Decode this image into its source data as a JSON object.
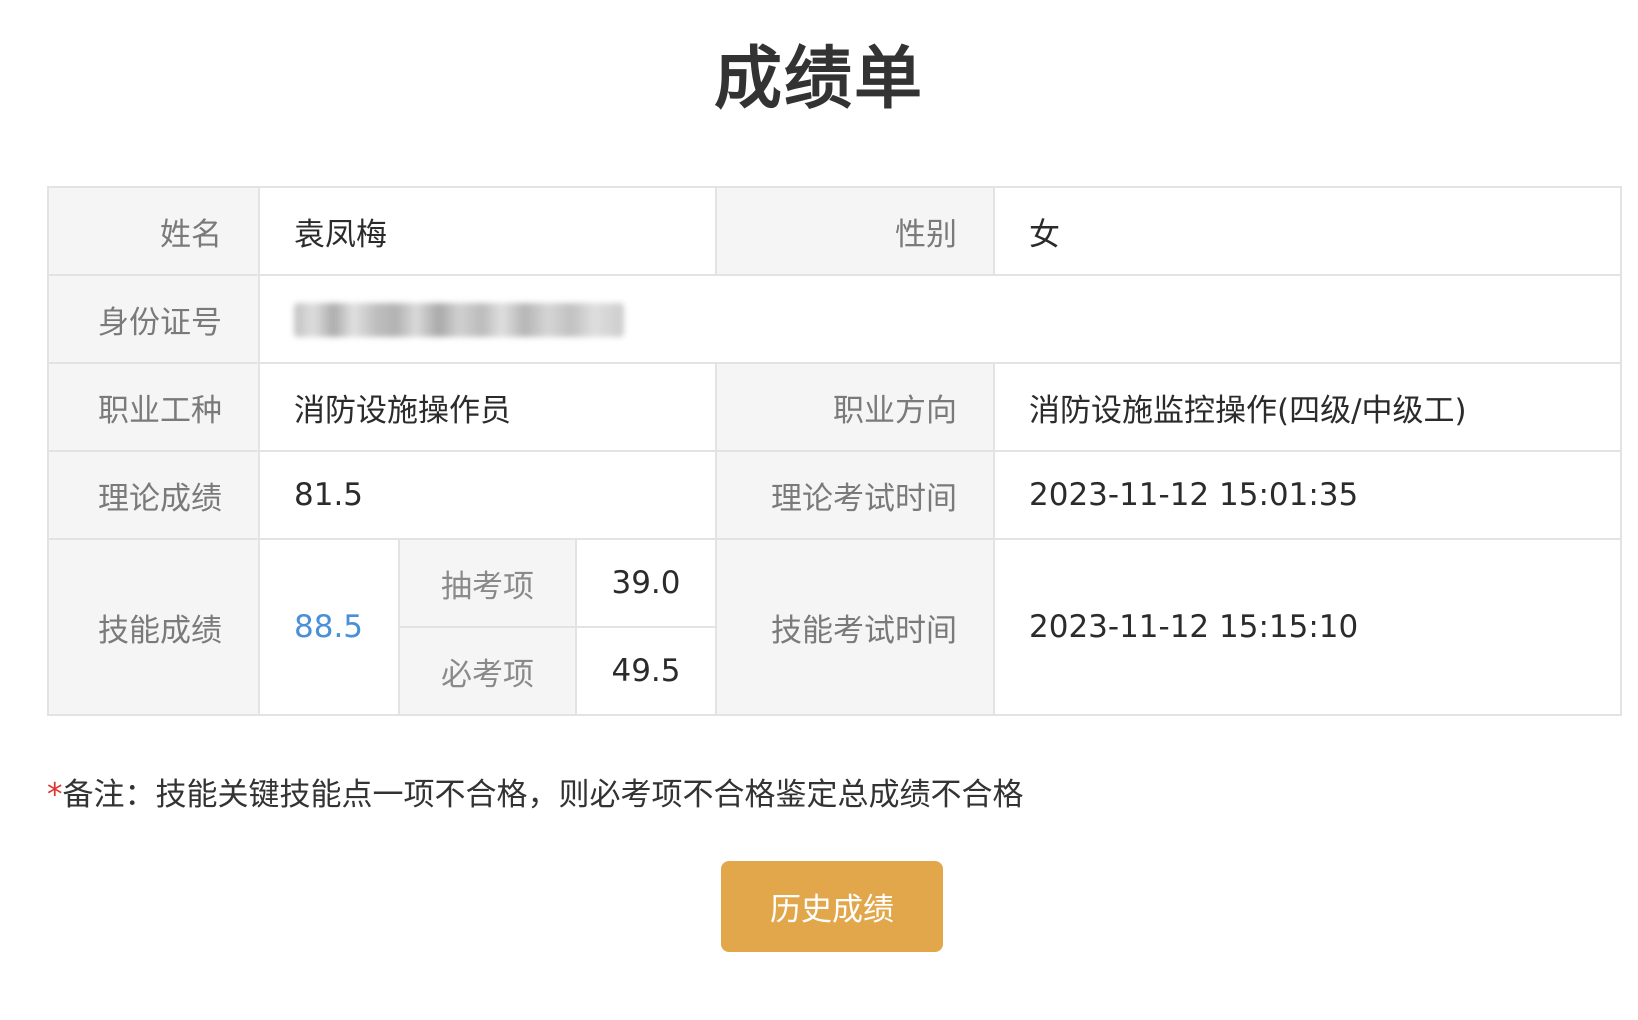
{
  "page": {
    "title": "成绩单"
  },
  "info": {
    "name_label": "姓名",
    "name_value": "袁凤梅",
    "gender_label": "性别",
    "gender_value": "女",
    "id_label": "身份证号",
    "id_value_obscured": true,
    "occupation_label": "职业工种",
    "occupation_value": "消防设施操作员",
    "direction_label": "职业方向",
    "direction_value": "消防设施监控操作(四级/中级工)"
  },
  "theory": {
    "score_label": "理论成绩",
    "score_value": "81.5",
    "time_label": "理论考试时间",
    "time_value": "2023-11-12 15:01:35"
  },
  "skill": {
    "score_label": "技能成绩",
    "score_value": "88.5",
    "random_label": "抽考项",
    "random_value": "39.0",
    "required_label": "必考项",
    "required_value": "49.5",
    "time_label": "技能考试时间",
    "time_value": "2023-11-12 15:15:10"
  },
  "remark": {
    "star": "*",
    "text": "备注：技能关键技能点一项不合格，则必考项不合格鉴定总成绩不合格"
  },
  "actions": {
    "history_label": "历史成绩"
  },
  "colors": {
    "button_bg": "#e2a74b",
    "label_bg": "#f5f5f5",
    "border": "#e3e3e3",
    "skill_score": "#4a90d9",
    "remark_star": "#e03030"
  }
}
